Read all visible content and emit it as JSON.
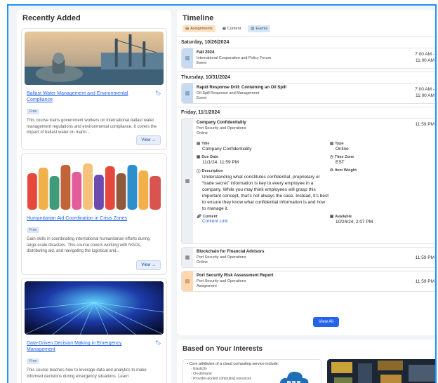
{
  "recently_added": {
    "title": "Recently Added",
    "courses": [
      {
        "title": "Ballast Water Management and Environmental Compliance",
        "badge": "Free",
        "description": "This course trains government workers on international ballast water management regulations and environmental compliance. It covers the impact of ballast water on marin...",
        "view_label": "View →"
      },
      {
        "title": "Humanitarian Aid Coordination in Crisis Zones",
        "badge": "Free",
        "description": "Gain skills in coordinating international humanitarian efforts during large-scale disasters. This course covers working with NGOs, distributing aid, and navigating the logistical and...",
        "view_label": "View →"
      },
      {
        "title": "Data-Driven Decision Making in Emergency Management",
        "badge": "Free",
        "description": "This course teaches how to leverage data and analytics to make informed decisions during emergency situations. Learn",
        "view_label": "View →"
      }
    ]
  },
  "timeline": {
    "title": "Timeline",
    "filters": [
      "Assignments",
      "Content",
      "Events"
    ],
    "days": [
      {
        "date": "Saturday, 10/26/2024",
        "items": [
          {
            "title": "Fall 2024",
            "subtitle": "International Cooperation and Policy Forum",
            "type": "Event",
            "time_start": "7:00 AM -",
            "time_end": "11:00 AM"
          }
        ]
      },
      {
        "date": "Thursday, 10/31/2024",
        "items": [
          {
            "title": "Rapid Response Drill: Containing an Oil Spill",
            "subtitle": "Oil Spill Response and Management",
            "type": "Event",
            "time_start": "7:00 AM -",
            "time_end": "11:00 AM"
          }
        ]
      },
      {
        "date": "Friday, 11/1/2024",
        "expanded": {
          "title": "Company Confidentiality",
          "subtitle": "Port Security and Operations",
          "type": "Online",
          "time": "11:59 PM",
          "labels": {
            "title": "Title",
            "type": "Type",
            "due_date": "Due Date",
            "time_zone": "Time Zone",
            "description": "Description",
            "item_weight": "Item Weight",
            "content": "Content",
            "available": "Available"
          },
          "values": {
            "title": "Company Confidentiality",
            "type": "Online",
            "due_date": "11/1/24, 11:59 PM",
            "time_zone": "EST",
            "description": "Understanding what constitutes confidential, proprietary or “trade secret” information is key to every employee in a company. While you may think employees will grasp this important concept, that’s not always the case. Instead, it’s best to ensure they know what confidential information is and how to manage it.",
            "content": "Content Link",
            "available": "10/24/24, 2:07 PM"
          }
        },
        "items": [
          {
            "title": "Blockchain for Financial Advisors",
            "subtitle": "Port Security and Operations",
            "type": "Online",
            "time": "11:59 PM"
          },
          {
            "title": "Port Security Risk Assessment Report",
            "subtitle": "Port Security and Operations",
            "type": "Assignment",
            "time": "11:59 PM"
          }
        ]
      }
    ],
    "view_all": "View All"
  },
  "interests": {
    "title": "Based on Your Interests",
    "card1_heading": "• Core attributes of a cloud computing service include:",
    "card1_points": [
      "◦ Elasticity",
      "◦ On-demand",
      "◦ Provider-pooled computing resources"
    ]
  }
}
